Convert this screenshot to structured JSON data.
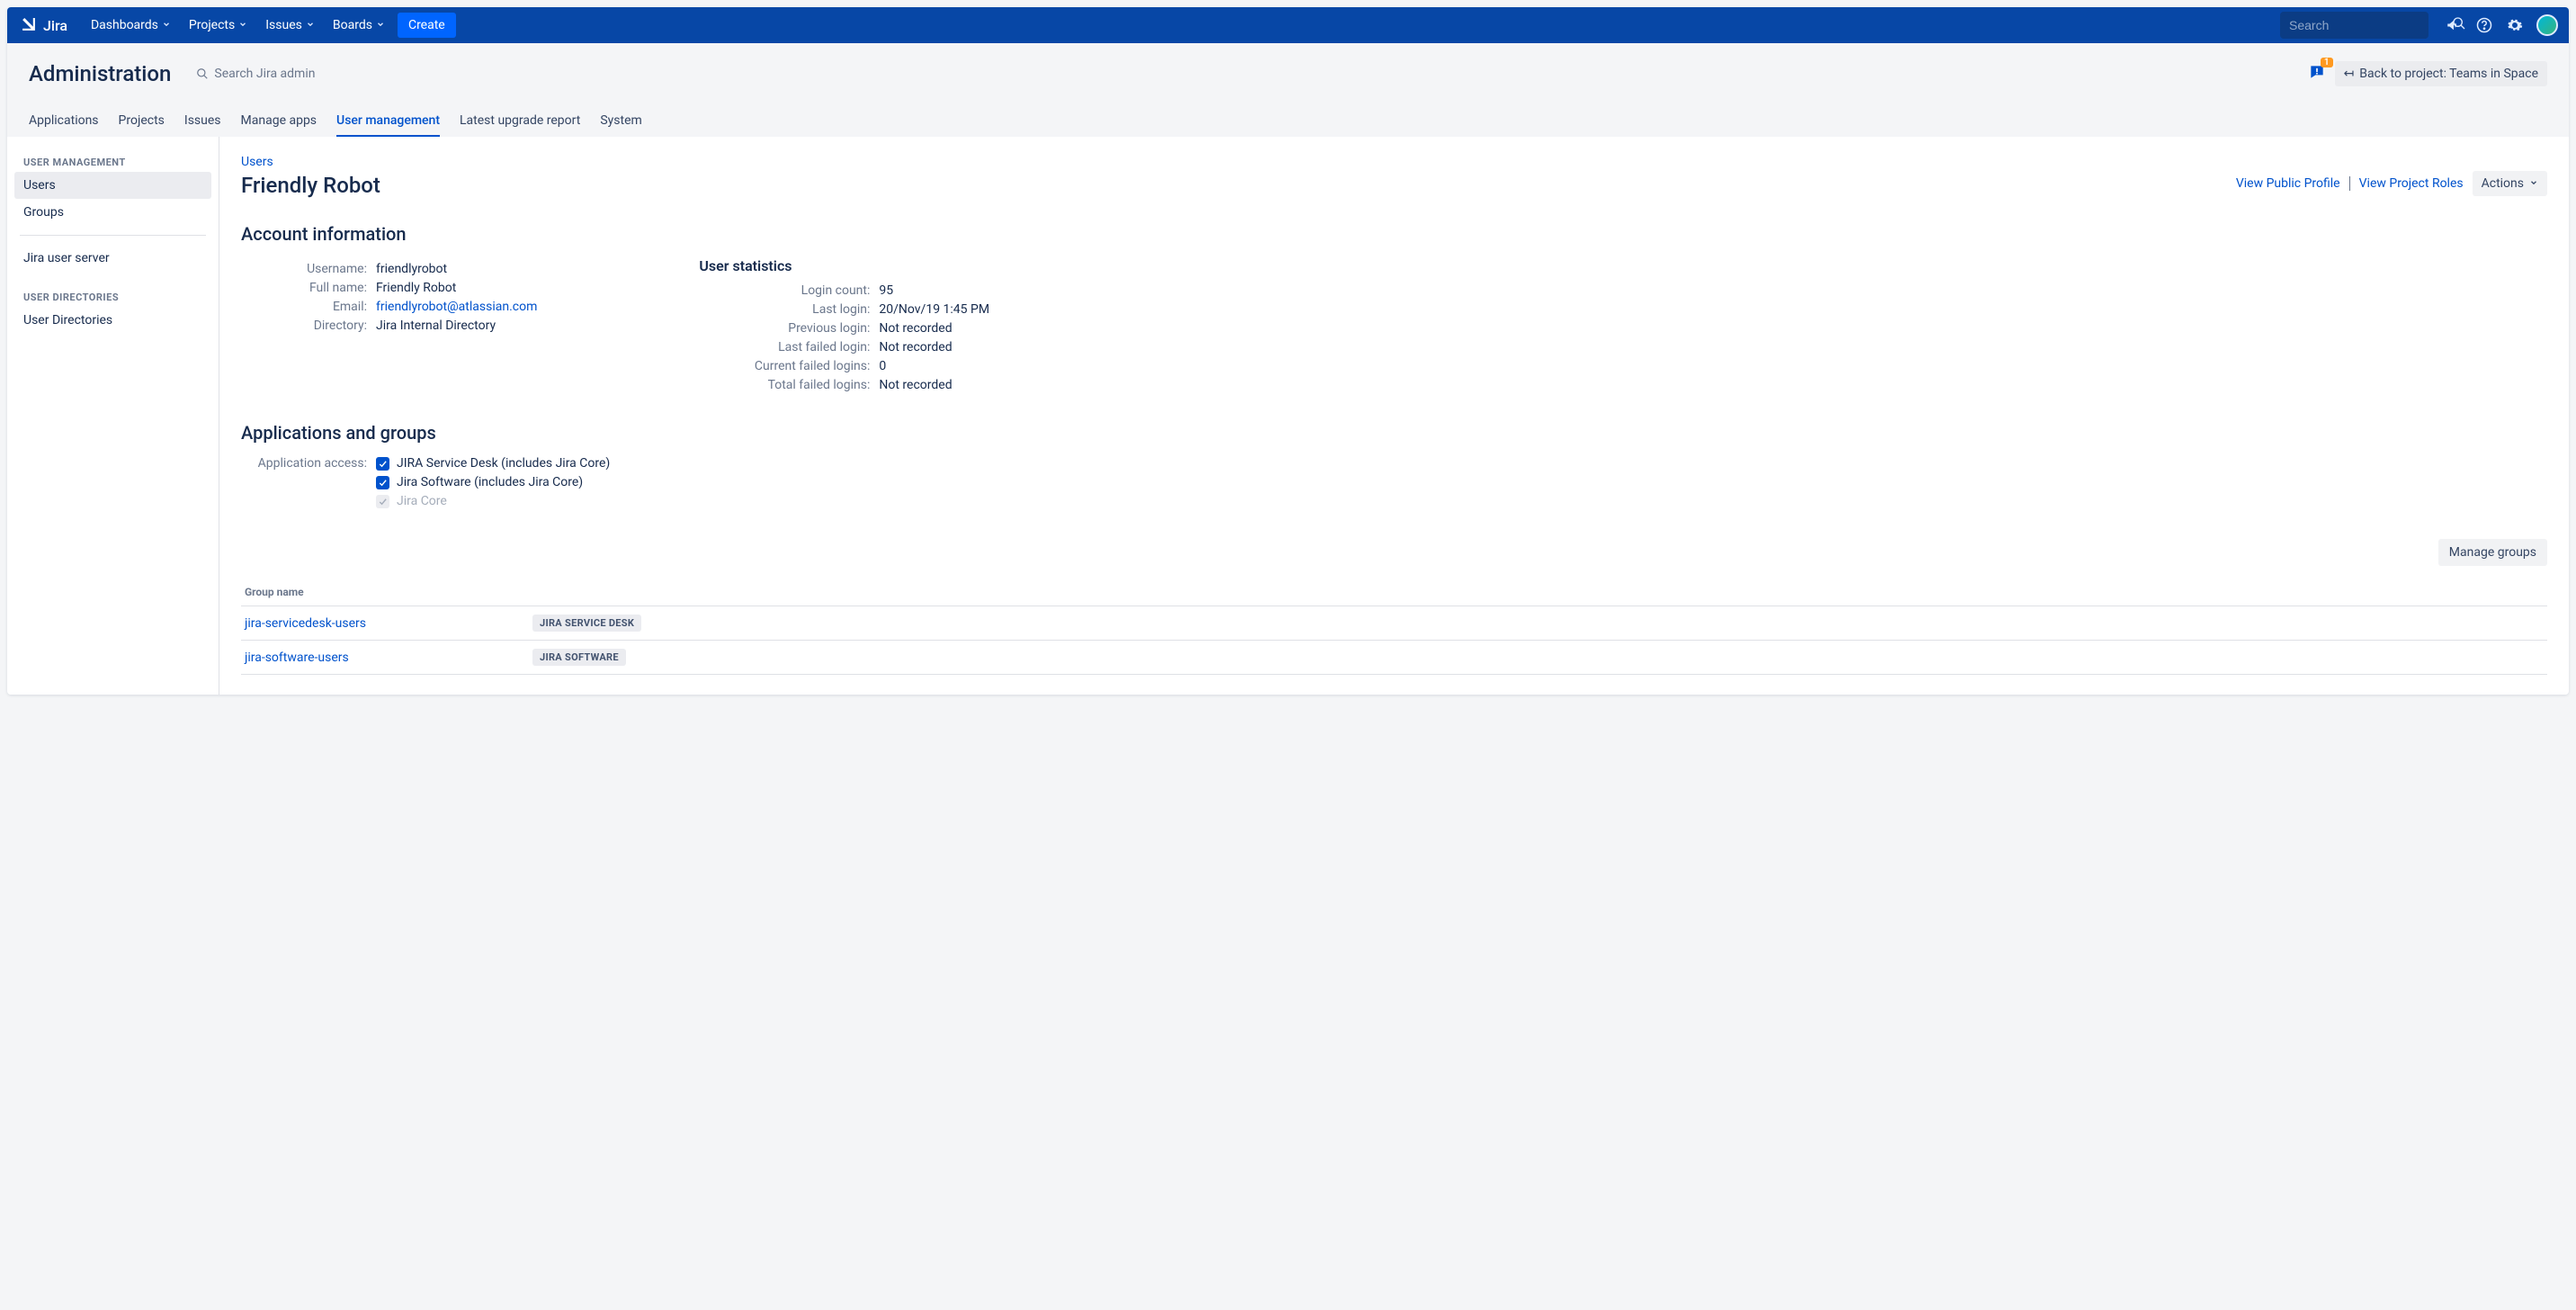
{
  "topnav": {
    "logo_text": "Jira",
    "items": [
      "Dashboards",
      "Projects",
      "Issues",
      "Boards"
    ],
    "create_label": "Create",
    "search_placeholder": "Search"
  },
  "admin_header": {
    "title": "Administration",
    "search_placeholder": "Search Jira admin",
    "feedback_badge": "1",
    "back_label": "Back to project: Teams in Space",
    "tabs": [
      "Applications",
      "Projects",
      "Issues",
      "Manage apps",
      "User management",
      "Latest upgrade report",
      "System"
    ],
    "active_tab_index": 4
  },
  "sidebar": {
    "section1_title": "USER MANAGEMENT",
    "section1_items": [
      "Users",
      "Groups"
    ],
    "section1_active_index": 0,
    "section2_items": [
      "Jira user server"
    ],
    "section3_title": "USER DIRECTORIES",
    "section3_items": [
      "User Directories"
    ]
  },
  "page": {
    "breadcrumb": "Users",
    "title": "Friendly Robot",
    "actions": {
      "view_public_profile": "View Public Profile",
      "view_project_roles": "View Project Roles",
      "actions_label": "Actions"
    }
  },
  "account_info": {
    "section_title": "Account information",
    "rows": [
      {
        "label": "Username:",
        "value": "friendlyrobot",
        "link": false
      },
      {
        "label": "Full name:",
        "value": "Friendly Robot",
        "link": false
      },
      {
        "label": "Email:",
        "value": "friendlyrobot@atlassian.com",
        "link": true
      },
      {
        "label": "Directory:",
        "value": "Jira Internal Directory",
        "link": false
      }
    ]
  },
  "user_stats": {
    "title": "User statistics",
    "rows": [
      {
        "label": "Login count:",
        "value": "95"
      },
      {
        "label": "Last login:",
        "value": "20/Nov/19 1:45 PM"
      },
      {
        "label": "Previous login:",
        "value": "Not recorded"
      },
      {
        "label": "Last failed login:",
        "value": "Not recorded"
      },
      {
        "label": "Current failed logins:",
        "value": "0"
      },
      {
        "label": "Total failed logins:",
        "value": "Not recorded"
      }
    ]
  },
  "apps_groups": {
    "section_title": "Applications and groups",
    "app_access_label": "Application access:",
    "checks": [
      {
        "label": "JIRA Service Desk (includes Jira Core)",
        "checked": true,
        "disabled": false
      },
      {
        "label": "Jira Software (includes Jira Core)",
        "checked": true,
        "disabled": false
      },
      {
        "label": "Jira Core",
        "checked": true,
        "disabled": true
      }
    ],
    "manage_groups_label": "Manage groups",
    "group_header": "Group name",
    "groups": [
      {
        "name": "jira-servicedesk-users",
        "badge": "JIRA SERVICE DESK"
      },
      {
        "name": "jira-software-users",
        "badge": "JIRA SOFTWARE"
      }
    ]
  }
}
